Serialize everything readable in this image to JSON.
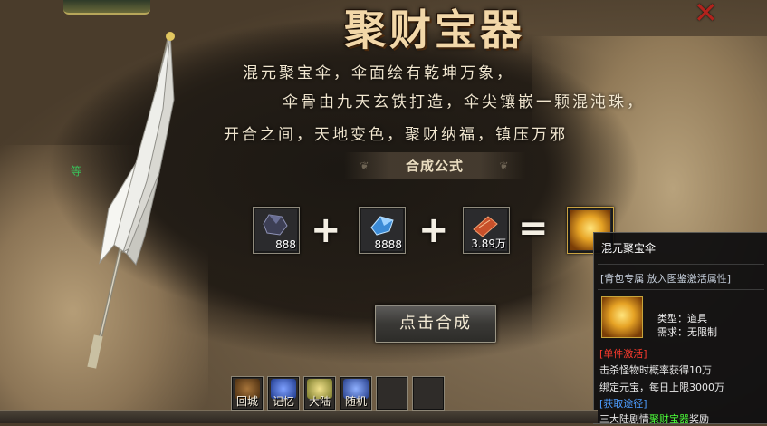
{
  "title": "聚财宝器",
  "description": [
    "混元聚宝伞，伞面绘有乾坤万象，",
    "伞骨由九天玄铁打造，伞尖镶嵌一颗混沌珠，",
    "开合之间，天地变色，聚财纳福，镇压万邪"
  ],
  "formula": {
    "label": "合成公式",
    "ingredients": [
      {
        "icon": "dark-ore-icon",
        "count": "888"
      },
      {
        "icon": "blue-crystal-icon",
        "count": "8888"
      },
      {
        "icon": "red-scroll-icon",
        "count": "3.89万"
      }
    ],
    "plus": "+",
    "equals": "=",
    "result_icon": "golden-treasure-icon"
  },
  "synth_button": "点击合成",
  "tooltip": {
    "name": "混元聚宝伞",
    "tag": "[背包专属 放入图鉴激活属性]",
    "type": "类型：道具",
    "require": "需求：无限制",
    "section1": "[单件激活]",
    "line1": "击杀怪物时概率获得10万",
    "line2": "绑定元宝，每日上限3000万",
    "section2": "[获取途径]",
    "line3_prefix": "三大陆剧情",
    "line3_highlight": "聚财宝器",
    "line3_suffix": "奖励"
  },
  "hotbar": [
    {
      "label": "回城",
      "icon": "return-city-icon"
    },
    {
      "label": "记忆",
      "icon": "memory-icon"
    },
    {
      "label": "大陆",
      "icon": "continent-icon"
    },
    {
      "label": "随机",
      "icon": "random-icon"
    },
    {
      "label": "",
      "icon": ""
    },
    {
      "label": "",
      "icon": ""
    }
  ],
  "side_text": "等",
  "close_symbol": "✕"
}
